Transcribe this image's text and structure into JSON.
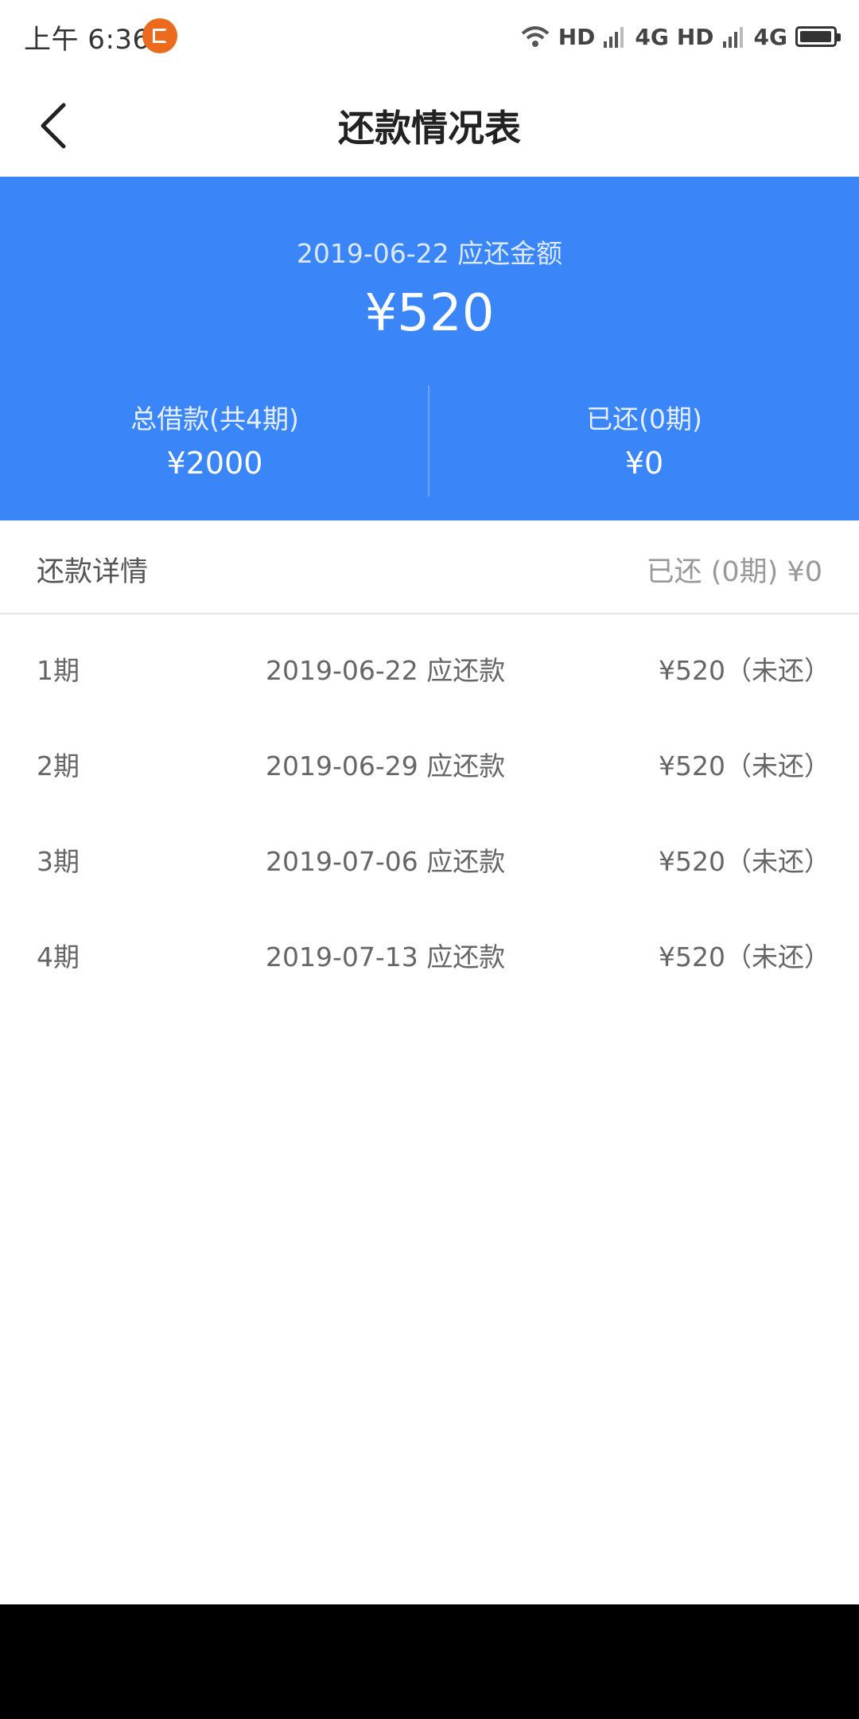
{
  "status_bar": {
    "time": "上午 6:36",
    "network_1": "HD",
    "net_type_1": "4G",
    "network_2": "HD",
    "net_type_2": "4G"
  },
  "nav": {
    "title": "还款情况表",
    "back_icon": "chevron-left-icon"
  },
  "summary": {
    "due_label": "2019-06-22 应还金额",
    "due_amount": "¥520",
    "total_label": "总借款(共4期)",
    "total_value": "¥2000",
    "paid_label": "已还(0期)",
    "paid_value": "¥0",
    "background_color": "#3a86f8"
  },
  "details": {
    "title": "还款详情",
    "paid_summary": "已还 (0期) ¥0"
  },
  "schedule": [
    {
      "period": "1期",
      "date": "2019-06-22 应还款",
      "amount": "¥520（未还）"
    },
    {
      "period": "2期",
      "date": "2019-06-29 应还款",
      "amount": "¥520（未还）"
    },
    {
      "period": "3期",
      "date": "2019-07-06 应还款",
      "amount": "¥520（未还）"
    },
    {
      "period": "4期",
      "date": "2019-07-13 应还款",
      "amount": "¥520（未还）"
    }
  ]
}
